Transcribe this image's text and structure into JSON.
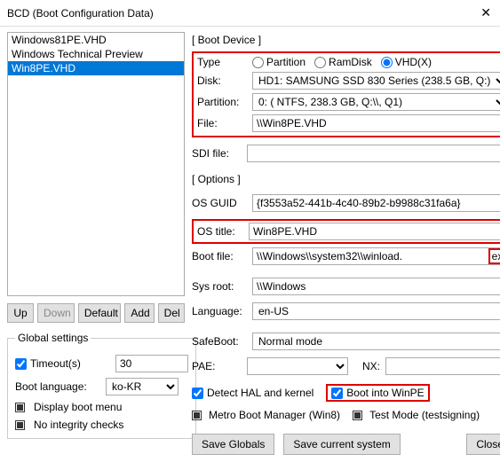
{
  "title": "BCD  (Boot Configuration Data)",
  "list": {
    "items": [
      "Windows81PE.VHD",
      "Windows Technical Preview",
      "Win8PE.VHD"
    ],
    "selected_index": 2
  },
  "list_buttons": {
    "up": "Up",
    "down": "Down",
    "default": "Default",
    "add": "Add",
    "del": "Del"
  },
  "global": {
    "legend": "Global settings",
    "timeout_label": "Timeout(s)",
    "timeout_value": "30",
    "bootlang_label": "Boot language:",
    "bootlang_value": "ko-KR",
    "display_boot_menu": "Display boot menu",
    "no_integrity": "No integrity checks"
  },
  "boot_device": {
    "section": "[ Boot Device ]",
    "type_label": "Type",
    "type_options": {
      "partition": "Partition",
      "ramdisk": "RamDisk",
      "vhdx": "VHD(X)"
    },
    "disk_label": "Disk:",
    "disk_value": "HD1: SAMSUNG SSD 830 Series (238.5 GB, Q:)",
    "partition_label": "Partition:",
    "partition_value": "0: ( NTFS, 238.3 GB, Q:\\\\, Q1)",
    "file_label": "File:",
    "file_value": "\\\\Win8PE.VHD",
    "sdi_label": "SDI file:"
  },
  "options": {
    "section": "[ Options ]",
    "guid_label": "OS GUID",
    "guid_value": "{f3553a52-441b-4c40-89b2-b9988c31fa6a}",
    "ostitle_label": "OS title:",
    "ostitle_value": "Win8PE.VHD",
    "bootfile_label": "Boot file:",
    "bootfile_prefix": "\\\\Windows\\\\system32\\\\winload.",
    "bootfile_suffix": "exe",
    "sysroot_label": "Sys root:",
    "sysroot_value": "\\\\Windows",
    "lang_label": "Language:",
    "lang_value": "en-US",
    "safeboot_label": "SafeBoot:",
    "safeboot_value": "Normal mode",
    "pae_label": "PAE:",
    "nx_label": "NX:",
    "detect_hal": "Detect HAL and kernel",
    "boot_winpe": "Boot into WinPE",
    "metro": "Metro Boot Manager (Win8)",
    "testmode": "Test Mode (testsigning)"
  },
  "buttons": {
    "save_globals": "Save Globals",
    "save_current": "Save current system",
    "close": "Close"
  }
}
